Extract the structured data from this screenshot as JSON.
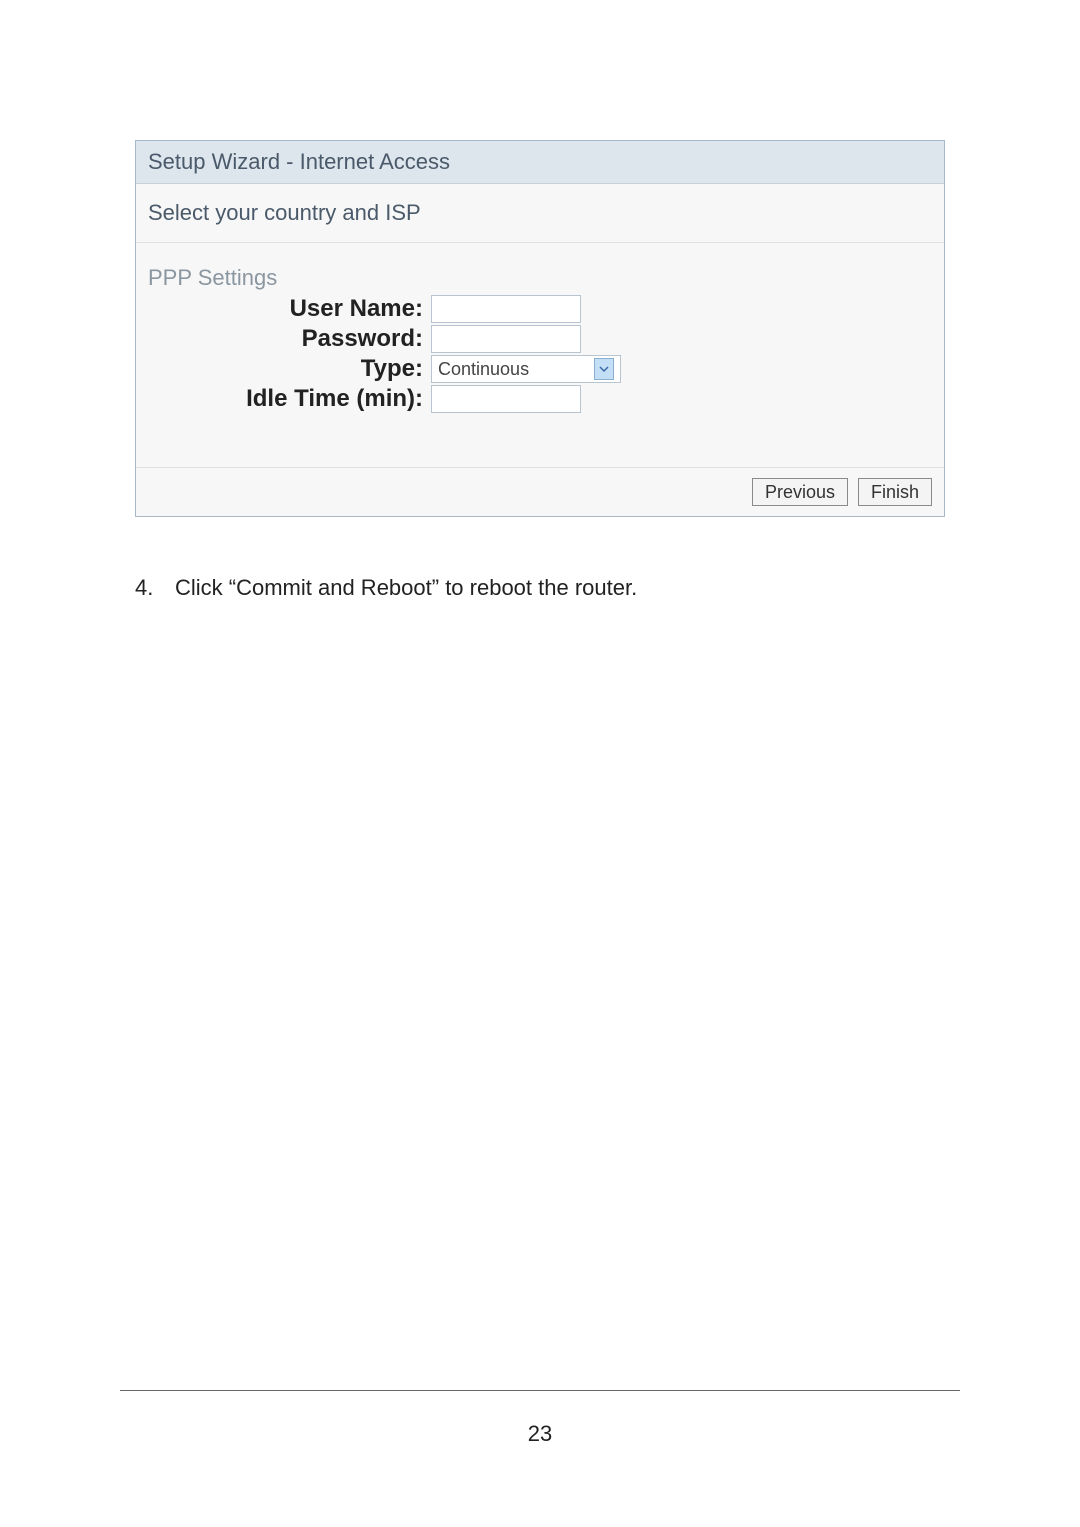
{
  "wizard": {
    "title": "Setup Wizard - Internet Access",
    "subtitle": "Select your country and ISP",
    "section_label": "PPP Settings",
    "fields": {
      "username_label": "User Name:",
      "username_value": "",
      "password_label": "Password:",
      "password_value": "",
      "type_label": "Type:",
      "type_value": "Continuous",
      "idle_label": "Idle Time (min):",
      "idle_value": ""
    },
    "buttons": {
      "previous": "Previous",
      "finish": "Finish"
    }
  },
  "instruction": {
    "number": "4.",
    "text": "Click “Commit and Reboot” to reboot the router."
  },
  "page_number": "23"
}
